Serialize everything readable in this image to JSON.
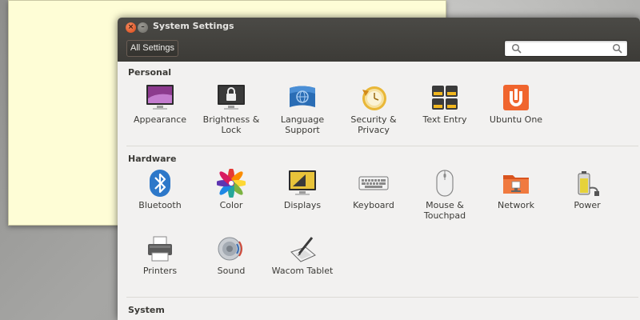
{
  "window": {
    "title": "System Settings",
    "all_settings_label": "All Settings",
    "search": {
      "value": "",
      "placeholder": ""
    }
  },
  "sections": {
    "personal": {
      "title": "Personal",
      "items": [
        {
          "label": "Appearance",
          "icon": "appearance-icon"
        },
        {
          "label": "Brightness &\nLock",
          "icon": "lock-icon"
        },
        {
          "label": "Language\nSupport",
          "icon": "language-icon"
        },
        {
          "label": "Security &\nPrivacy",
          "icon": "security-icon"
        },
        {
          "label": "Text Entry",
          "icon": "keyboard-layout-icon"
        },
        {
          "label": "Ubuntu One",
          "icon": "ubuntu-one-icon"
        }
      ]
    },
    "hardware": {
      "title": "Hardware",
      "items": [
        {
          "label": "Bluetooth",
          "icon": "bluetooth-icon"
        },
        {
          "label": "Color",
          "icon": "color-icon"
        },
        {
          "label": "Displays",
          "icon": "display-icon"
        },
        {
          "label": "Keyboard",
          "icon": "keyboard-icon"
        },
        {
          "label": "Mouse &\nTouchpad",
          "icon": "mouse-icon"
        },
        {
          "label": "Network",
          "icon": "network-folder-icon"
        },
        {
          "label": "Power",
          "icon": "battery-icon"
        },
        {
          "label": "Printers",
          "icon": "printer-icon"
        },
        {
          "label": "Sound",
          "icon": "speaker-icon"
        },
        {
          "label": "Wacom Tablet",
          "icon": "tablet-pen-icon"
        }
      ]
    },
    "system": {
      "title": "System"
    }
  },
  "colors": {
    "titlebar": "#3c3b37",
    "window_bg": "#f2f1f0",
    "note_bg": "#fefdd6",
    "close_button": "#dd4814",
    "ubuntu_orange": "#f0652e"
  }
}
